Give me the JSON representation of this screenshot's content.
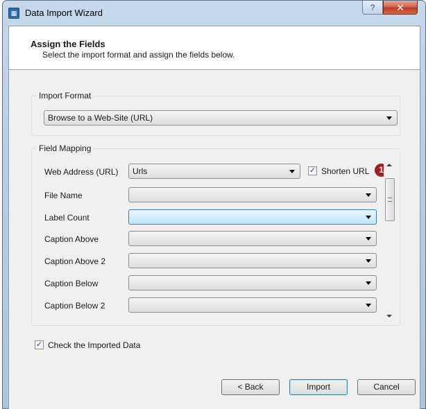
{
  "window": {
    "title": "Data Import Wizard",
    "help_glyph": "?",
    "close_glyph": "✕",
    "app_icon_glyph": "▦"
  },
  "header": {
    "title": "Assign the Fields",
    "subtitle": "Select the import format and assign the fields below."
  },
  "import_format": {
    "label": "Import Format",
    "selected": "Browse to a Web-Site (URL)"
  },
  "field_mapping": {
    "label": "Field Mapping",
    "rows": [
      {
        "label": "Web Address (URL)",
        "value": "Urls"
      },
      {
        "label": "File Name",
        "value": ""
      },
      {
        "label": "Label Count",
        "value": ""
      },
      {
        "label": "Caption Above",
        "value": ""
      },
      {
        "label": "Caption Above 2",
        "value": ""
      },
      {
        "label": "Caption Below",
        "value": ""
      },
      {
        "label": "Caption Below 2",
        "value": ""
      }
    ],
    "shorten_url": {
      "label": "Shorten URL",
      "checked": true,
      "glyph": "✓"
    },
    "badge": "1"
  },
  "check_imported": {
    "label": "Check the Imported Data",
    "checked": true,
    "glyph": "✓"
  },
  "buttons": {
    "back": "< Back",
    "import": "Import",
    "cancel": "Cancel"
  },
  "colors": {
    "badge": "#a31f1f",
    "close": "#c4412a",
    "focus": "#3c7fb1"
  }
}
